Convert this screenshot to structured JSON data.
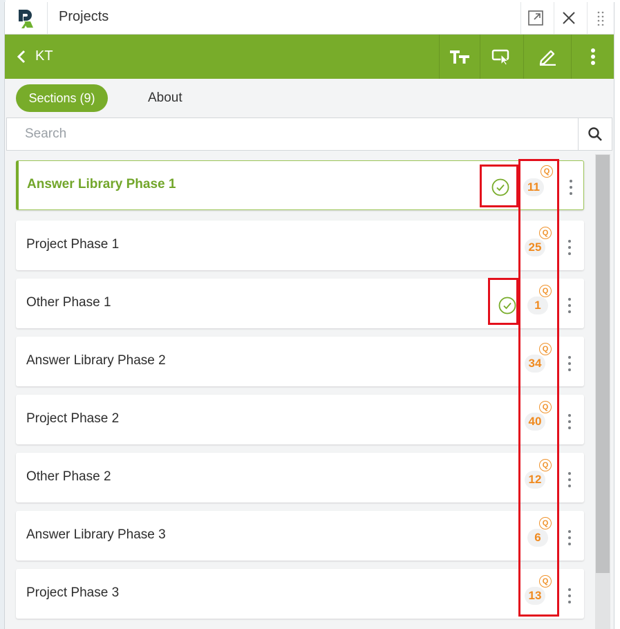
{
  "window": {
    "title": "Projects"
  },
  "header": {
    "project_name": "KT"
  },
  "tabs": [
    {
      "label": "Sections (9)",
      "active": true
    },
    {
      "label": "About",
      "active": false
    }
  ],
  "search": {
    "placeholder": "Search",
    "value": ""
  },
  "sections": [
    {
      "title": "Answer Library Phase 1",
      "count": "11",
      "count_icon_letter": "Q",
      "completed": true,
      "selected": true
    },
    {
      "title": "Project Phase 1",
      "count": "25",
      "count_icon_letter": "Q",
      "completed": false,
      "selected": false
    },
    {
      "title": "Other Phase 1",
      "count": "1",
      "count_icon_letter": "Q",
      "completed": true,
      "selected": false
    },
    {
      "title": "Answer Library Phase 2",
      "count": "34",
      "count_icon_letter": "Q",
      "completed": false,
      "selected": false
    },
    {
      "title": "Project Phase 2",
      "count": "40",
      "count_icon_letter": "Q",
      "completed": false,
      "selected": false
    },
    {
      "title": "Other Phase 2",
      "count": "12",
      "count_icon_letter": "Q",
      "completed": false,
      "selected": false
    },
    {
      "title": "Answer Library Phase 3",
      "count": "6",
      "count_icon_letter": "Q",
      "completed": false,
      "selected": false
    },
    {
      "title": "Project Phase 3",
      "count": "13",
      "count_icon_letter": "Q",
      "completed": false,
      "selected": false
    }
  ],
  "icons": {
    "logo": "app-logo",
    "popout": "popout-icon",
    "close": "close-icon",
    "drag": "drag-handle-icon",
    "back": "back-chevron-icon",
    "text_size": "text-size-icon",
    "pointer": "pointer-select-icon",
    "edit": "pencil-icon",
    "more": "more-vertical-icon",
    "search": "search-icon",
    "completed": "check-circle-icon",
    "question": "question-badge-icon"
  },
  "colors": {
    "brand_green": "#78ac2a",
    "count_orange": "#f08a1f",
    "annotation_red": "#e3101c"
  }
}
